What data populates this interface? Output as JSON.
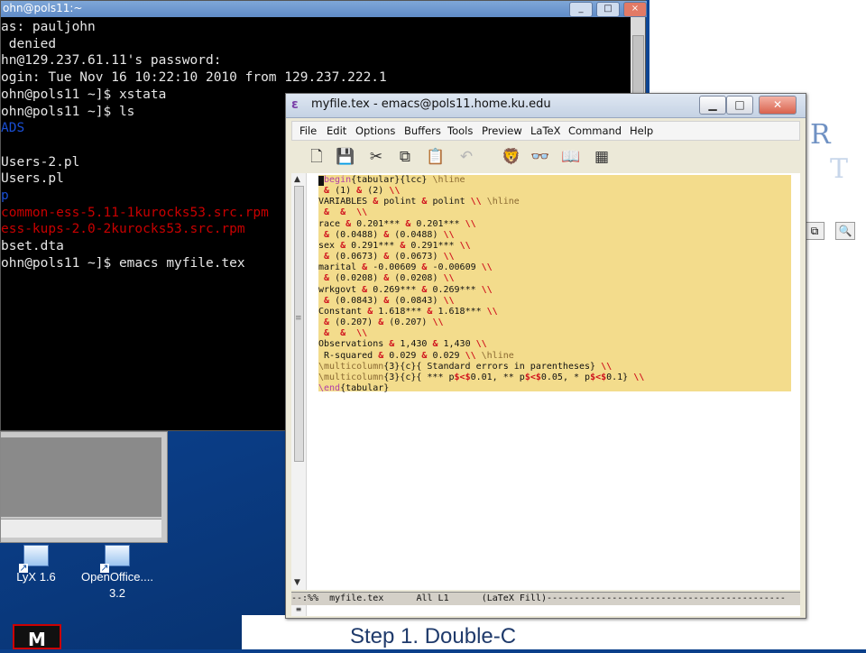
{
  "terminal": {
    "title": "ohn@pols11:~",
    "lines": [
      {
        "text": "as: pauljohn",
        "color": "normal"
      },
      {
        "text": " denied",
        "color": "normal"
      },
      {
        "text": "hn@129.237.61.11's password:",
        "color": "normal"
      },
      {
        "text": "ogin: Tue Nov 16 10:22:10 2010 from 129.237.222.1",
        "color": "normal"
      },
      {
        "text": "ohn@pols11 ~]$ xstata",
        "color": "normal"
      },
      {
        "text": "ohn@pols11 ~]$ ls",
        "color": "normal"
      },
      {
        "text": "ADS",
        "color": "blue"
      },
      {
        "text": "",
        "color": "normal"
      },
      {
        "text": "Users-2.pl",
        "color": "normal"
      },
      {
        "text": "Users.pl",
        "color": "normal"
      },
      {
        "text": "p",
        "color": "blue"
      },
      {
        "text": "common-ess-5.11-1kurocks53.src.rpm",
        "color": "red"
      },
      {
        "text": "ess-kups-2.0-2kurocks53.src.rpm",
        "color": "red"
      },
      {
        "text": "bset.dta",
        "color": "normal"
      },
      {
        "text": "ohn@pols11 ~]$ emacs myfile.tex",
        "color": "normal"
      }
    ]
  },
  "desktop": {
    "icons": [
      {
        "label": "LyX 1.6"
      },
      {
        "label": "OpenOffice....",
        "label2": "3.2"
      }
    ],
    "mcafee_label": "M",
    "right_doc_letters": [
      "R",
      "T"
    ],
    "step_caption": "Step 1. Double-C"
  },
  "emacs": {
    "title": "myfile.tex - emacs@pols11.home.ku.edu",
    "menu": [
      "File",
      "Edit",
      "Options",
      "Buffers",
      "Tools",
      "Preview",
      "LaTeX",
      "Command",
      "Help"
    ],
    "mode_line": "--:%%  myfile.tex      All L1      (LaTeX Fill)--------------------------------------------",
    "code_lines": [
      [
        [
          "kw",
          "\\begin"
        ],
        [
          "n",
          "{tabular}{lcc} "
        ],
        [
          "cm",
          "\\hline"
        ]
      ],
      [
        [
          "br",
          " & "
        ],
        [
          "n",
          "(1) "
        ],
        [
          "br",
          "& "
        ],
        [
          "n",
          "(2) "
        ],
        [
          "br",
          "\\\\"
        ]
      ],
      [
        [
          "n",
          "VARIABLES "
        ],
        [
          "br",
          "& "
        ],
        [
          "n",
          "polint "
        ],
        [
          "br",
          "& "
        ],
        [
          "n",
          "polint "
        ],
        [
          "br",
          "\\\\ "
        ],
        [
          "cm",
          "\\hline"
        ]
      ],
      [
        [
          "br",
          " &  &  \\\\"
        ]
      ],
      [
        [
          "n",
          "race "
        ],
        [
          "br",
          "& "
        ],
        [
          "n",
          "0.201*** "
        ],
        [
          "br",
          "& "
        ],
        [
          "n",
          "0.201*** "
        ],
        [
          "br",
          "\\\\"
        ]
      ],
      [
        [
          "br",
          " & "
        ],
        [
          "n",
          "(0.0488) "
        ],
        [
          "br",
          "& "
        ],
        [
          "n",
          "(0.0488) "
        ],
        [
          "br",
          "\\\\"
        ]
      ],
      [
        [
          "n",
          "sex "
        ],
        [
          "br",
          "& "
        ],
        [
          "n",
          "0.291*** "
        ],
        [
          "br",
          "& "
        ],
        [
          "n",
          "0.291*** "
        ],
        [
          "br",
          "\\\\"
        ]
      ],
      [
        [
          "br",
          " & "
        ],
        [
          "n",
          "(0.0673) "
        ],
        [
          "br",
          "& "
        ],
        [
          "n",
          "(0.0673) "
        ],
        [
          "br",
          "\\\\"
        ]
      ],
      [
        [
          "n",
          "marital "
        ],
        [
          "br",
          "& "
        ],
        [
          "n",
          "-0.00609 "
        ],
        [
          "br",
          "& "
        ],
        [
          "n",
          "-0.00609 "
        ],
        [
          "br",
          "\\\\"
        ]
      ],
      [
        [
          "br",
          " & "
        ],
        [
          "n",
          "(0.0208) "
        ],
        [
          "br",
          "& "
        ],
        [
          "n",
          "(0.0208) "
        ],
        [
          "br",
          "\\\\"
        ]
      ],
      [
        [
          "n",
          "wrkgovt "
        ],
        [
          "br",
          "& "
        ],
        [
          "n",
          "0.269*** "
        ],
        [
          "br",
          "& "
        ],
        [
          "n",
          "0.269*** "
        ],
        [
          "br",
          "\\\\"
        ]
      ],
      [
        [
          "br",
          " & "
        ],
        [
          "n",
          "(0.0843) "
        ],
        [
          "br",
          "& "
        ],
        [
          "n",
          "(0.0843) "
        ],
        [
          "br",
          "\\\\"
        ]
      ],
      [
        [
          "n",
          "Constant "
        ],
        [
          "br",
          "& "
        ],
        [
          "n",
          "1.618*** "
        ],
        [
          "br",
          "& "
        ],
        [
          "n",
          "1.618*** "
        ],
        [
          "br",
          "\\\\"
        ]
      ],
      [
        [
          "br",
          " & "
        ],
        [
          "n",
          "(0.207) "
        ],
        [
          "br",
          "& "
        ],
        [
          "n",
          "(0.207) "
        ],
        [
          "br",
          "\\\\"
        ]
      ],
      [
        [
          "br",
          " &  &  \\\\"
        ]
      ],
      [
        [
          "n",
          "Observations "
        ],
        [
          "br",
          "& "
        ],
        [
          "n",
          "1,430 "
        ],
        [
          "br",
          "& "
        ],
        [
          "n",
          "1,430 "
        ],
        [
          "br",
          "\\\\"
        ]
      ],
      [
        [
          "n",
          " R-squared "
        ],
        [
          "br",
          "& "
        ],
        [
          "n",
          "0.029 "
        ],
        [
          "br",
          "& "
        ],
        [
          "n",
          "0.029 "
        ],
        [
          "br",
          "\\\\ "
        ],
        [
          "cm",
          "\\hline"
        ]
      ],
      [
        [
          "cm",
          "\\multicolumn"
        ],
        [
          "n",
          "{3}{c}{ Standard errors in parentheses} "
        ],
        [
          "br",
          "\\\\"
        ]
      ],
      [
        [
          "cm",
          "\\multicolumn"
        ],
        [
          "n",
          "{3}{c}{ *** p"
        ],
        [
          "br",
          "$<$"
        ],
        [
          "n",
          "0.01, ** p"
        ],
        [
          "br",
          "$<$"
        ],
        [
          "n",
          "0.05, * p"
        ],
        [
          "br",
          "$<$"
        ],
        [
          "n",
          "0.1} "
        ],
        [
          "br",
          "\\\\"
        ]
      ],
      [
        [
          "kw",
          "\\end"
        ],
        [
          "n",
          "{tabular}"
        ]
      ]
    ]
  }
}
